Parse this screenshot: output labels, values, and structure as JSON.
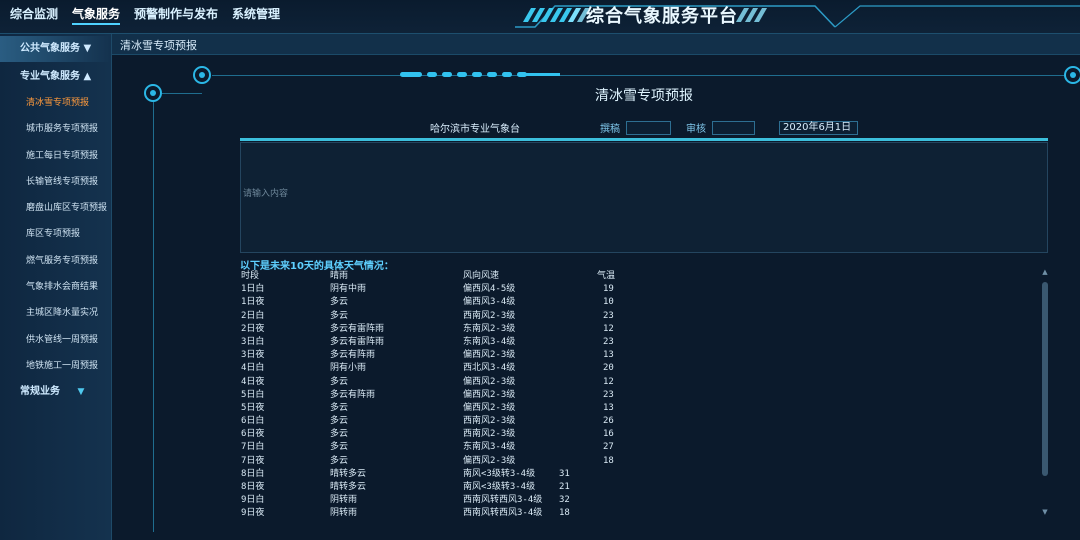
{
  "top_nav": [
    "综合监测",
    "气象服务",
    "预警制作与发布",
    "系统管理"
  ],
  "active_nav": "气象服务",
  "platform_title": "综合气象服务平台",
  "sidebar": {
    "group_public": "公共气象服务 ▼",
    "group_professional": "专业气象服务 ▲",
    "items": [
      "清冰雪专项预报",
      "城市服务专项预报",
      "施工每日专项预报",
      "长输管线专项预报",
      "磨盘山库区专项预报",
      "库区专项预报",
      "燃气服务专项预报",
      "气象排水会商结果",
      "主城区降水量实况",
      "供水管线一周预报",
      "地铁施工一周预报"
    ],
    "group_regular": "常规业务",
    "group_regular_caret": "▼"
  },
  "breadcrumb": "清冰雪专项预报",
  "main_title": "清冰雪专项预报",
  "meta": {
    "org": "哈尔滨市专业气象台",
    "writer_label": "撰稿",
    "reviewer_label": "审核",
    "date": "2020年6月1日"
  },
  "textarea_placeholder": "请输入内容",
  "forecast_header": "以下是未来10天的具体天气情况：",
  "table": {
    "headers": [
      "时段",
      "晴雨",
      "风向风速",
      "气温"
    ],
    "rows": [
      [
        "1日白",
        "阴有中雨",
        "偏西风4-5级",
        "19"
      ],
      [
        "1日夜",
        "多云",
        "偏西风3-4级",
        "10"
      ],
      [
        "2日白",
        "多云",
        "西南风2-3级",
        "23"
      ],
      [
        "2日夜",
        "多云有雷阵雨",
        "东南风2-3级",
        "12"
      ],
      [
        "3日白",
        "多云有雷阵雨",
        "东南风3-4级",
        "23"
      ],
      [
        "3日夜",
        "多云有阵雨",
        "偏西风2-3级",
        "13"
      ],
      [
        "4日白",
        "阴有小雨",
        "西北风3-4级",
        "20"
      ],
      [
        "4日夜",
        "多云",
        "偏西风2-3级",
        "12"
      ],
      [
        "5日白",
        "多云有阵雨",
        "偏西风2-3级",
        "23"
      ],
      [
        "5日夜",
        "多云",
        "偏西风2-3级",
        "13"
      ],
      [
        "6日白",
        "多云",
        "西南风2-3级",
        "26"
      ],
      [
        "6日夜",
        "多云",
        "西南风2-3级",
        "16"
      ],
      [
        "7日白",
        "多云",
        "东南风3-4级",
        "27"
      ],
      [
        "7日夜",
        "多云",
        "偏西风2-3级",
        "18"
      ],
      [
        "8日白",
        "晴转多云",
        "南风<3级转3-4级",
        "31"
      ],
      [
        "8日夜",
        "晴转多云",
        "南风<3级转3-4级",
        "21"
      ],
      [
        "9日白",
        "阴转雨",
        "西南风转西风3-4级",
        "32"
      ],
      [
        "9日夜",
        "阴转雨",
        "西南风转西风3-4级",
        "18"
      ]
    ]
  },
  "colors": {
    "accent": "#3cbfdc",
    "active_menu": "#ff9a3c",
    "header_text": "#5fd0ff"
  }
}
